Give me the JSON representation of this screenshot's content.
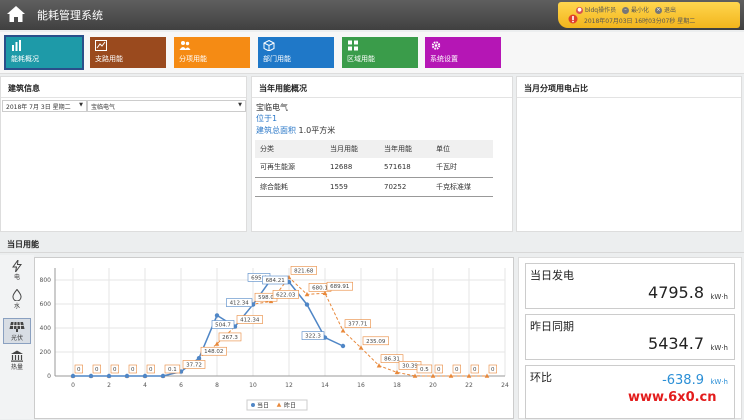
{
  "app": {
    "title": "能耗管理系统"
  },
  "user": {
    "role_label": "bldq操作员",
    "minimize_label": "最小化",
    "logout_label": "退出",
    "datetime": "2018年07月03日 16时03分07秒 星期二"
  },
  "nav": {
    "items": [
      {
        "label": "能耗概况",
        "color": "#1e9aa8"
      },
      {
        "label": "支路用能",
        "color": "#9a4a1e"
      },
      {
        "label": "分项用能",
        "color": "#f58b14"
      },
      {
        "label": "部门用能",
        "color": "#1f78c8"
      },
      {
        "label": "区域用能",
        "color": "#3a9c4a"
      },
      {
        "label": "系统设置",
        "color": "#b516b5"
      }
    ]
  },
  "building": {
    "title": "建筑信息",
    "date_select": "2018年 7月 3日 星期二",
    "building_select": "宝临电气"
  },
  "yearly": {
    "title": "当年用能概况",
    "name": "宝临电气",
    "location": "位于1",
    "area_label": "建筑总面积",
    "area_value": "1.0平方米",
    "headers": [
      "分类",
      "当月用能",
      "当年用能",
      "单位"
    ],
    "rows": [
      [
        "可再生能源",
        "12688",
        "571618",
        "千瓦时"
      ],
      [
        "综合能耗",
        "1559",
        "70252",
        "千克标准煤"
      ]
    ]
  },
  "monthly_share": {
    "title": "当月分项用电占比"
  },
  "daily": {
    "title": "当日用能",
    "tabs": [
      {
        "label": "电",
        "icon": "lightning-icon"
      },
      {
        "label": "水",
        "icon": "water-drop-icon"
      },
      {
        "label": "光伏",
        "icon": "solar-panel-icon"
      },
      {
        "label": "热量",
        "icon": "heat-icon"
      }
    ]
  },
  "stats": {
    "card1": {
      "label": "当日发电",
      "value": "4795.8",
      "unit": "kW·h"
    },
    "card2": {
      "label": "昨日同期",
      "value": "5434.7",
      "unit": "kW·h"
    },
    "card3": {
      "label": "环比",
      "value": "-638.9",
      "unit": "kW·h"
    }
  },
  "watermark": "www.6x0.cn",
  "chart_data": {
    "type": "line",
    "x": [
      0,
      1,
      2,
      3,
      4,
      5,
      6,
      7,
      8,
      9,
      10,
      11,
      12,
      13,
      14,
      15,
      16,
      17,
      18,
      19,
      20,
      21,
      22,
      23
    ],
    "xlim": [
      -1,
      24
    ],
    "ylim": [
      0,
      900
    ],
    "yticks": [
      0,
      200,
      400,
      600,
      800
    ],
    "xticks": [
      0,
      2,
      4,
      6,
      8,
      10,
      12,
      14,
      16,
      18,
      20,
      22,
      24
    ],
    "grid": true,
    "legend_position": "bottom",
    "series": [
      {
        "name": "当日",
        "color": "#4f86c6",
        "x": [
          0,
          1,
          2,
          3,
          4,
          5,
          6,
          7,
          8,
          9,
          10,
          11,
          12,
          13,
          14,
          15
        ],
        "values": [
          0,
          0,
          0,
          0,
          0,
          0.1,
          37,
          148,
          504.7,
          412.34,
          595,
          805,
          783.21,
          595,
          320,
          250
        ],
        "labels": {
          "9": "504.7",
          "10": "412.34",
          "11": "695.4",
          "12": "684.21",
          "14": "322.3"
        }
      },
      {
        "name": "昨日",
        "color": "#e8883a",
        "x": [
          0,
          1,
          2,
          3,
          4,
          5,
          6,
          7,
          8,
          9,
          10,
          11,
          12,
          13,
          14,
          15,
          16,
          17,
          18,
          19,
          20,
          21,
          22,
          23
        ],
        "values": [
          0,
          0,
          0,
          0,
          0,
          0.1,
          37.72,
          148.02,
          267.3,
          412.34,
          598.0,
          622.03,
          821.68,
          680.1,
          689.91,
          377.71,
          235.09,
          86.31,
          30.39,
          0.5,
          0,
          0,
          0,
          0
        ],
        "labels": {
          "0": "0",
          "1": "0",
          "2": "0",
          "3": "0",
          "4": "0",
          "5": "0.1",
          "6": "37.72",
          "7": "148.02",
          "8": "267.3",
          "9": "412.34",
          "10": "598.0",
          "11": "622.03",
          "12": "821.68",
          "13": "680.1",
          "14": "689.91",
          "15": "377.71",
          "16": "235.09",
          "17": "86.31",
          "18": "30.39",
          "19": "0.5",
          "20": "0",
          "21": "0",
          "22": "0",
          "23": "0"
        }
      }
    ]
  }
}
